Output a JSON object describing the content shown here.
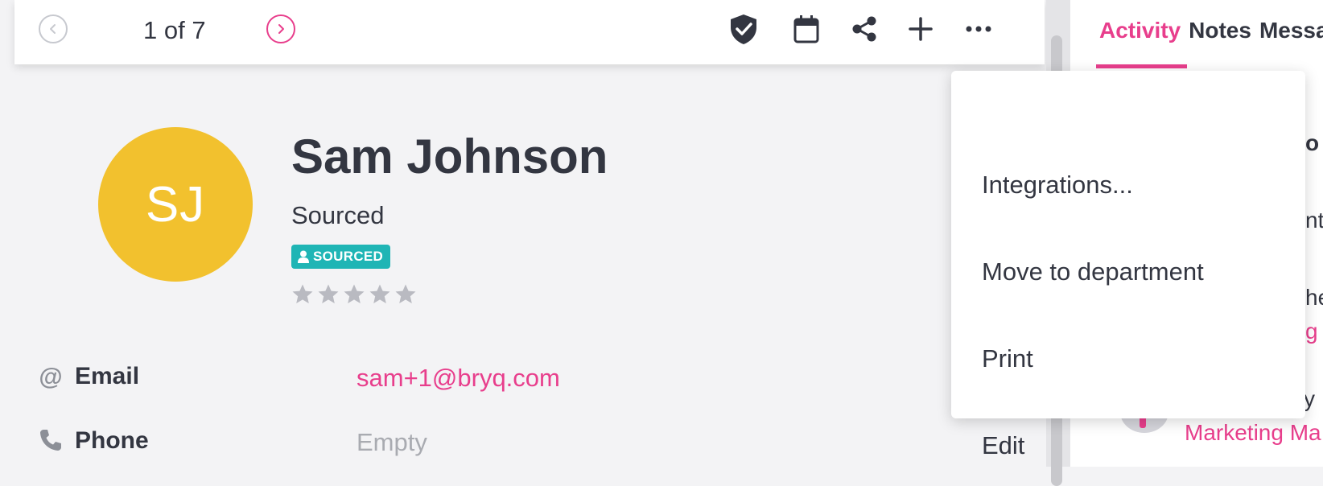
{
  "toolbar": {
    "pager": "1 of 7",
    "icons": [
      "chevron-left-icon",
      "chevron-right-icon",
      "shield-check-icon",
      "calendar-icon",
      "share-icon",
      "plus-icon",
      "more-icon"
    ]
  },
  "candidate": {
    "initials": "SJ",
    "name": "Sam Johnson",
    "stage": "Sourced",
    "badge": "SOURCED",
    "rating": 0,
    "rating_max": 5
  },
  "fields": {
    "email_label": "Email",
    "email_value": "sam+1@bryq.com",
    "phone_label": "Phone",
    "phone_value": "Empty"
  },
  "side": {
    "tabs": [
      "Activity",
      "Notes",
      "Messa"
    ],
    "fragments": [
      "o",
      "nt",
      "he",
      "g",
      "y",
      "Marketing Ma"
    ]
  },
  "menu": {
    "items": [
      "Integrations...",
      "Move to department",
      "Print",
      "Edit"
    ]
  },
  "colors": {
    "accent": "#e83e8c",
    "avatar": "#f2c12e",
    "badge": "#1fb5b5",
    "text": "#333641",
    "muted": "#a9abb1"
  }
}
